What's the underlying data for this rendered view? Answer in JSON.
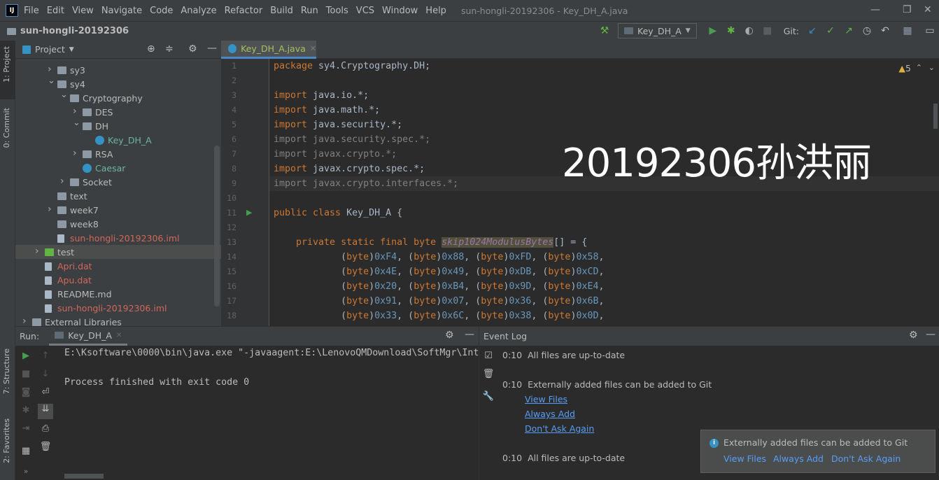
{
  "menu": {
    "items": [
      "File",
      "Edit",
      "View",
      "Navigate",
      "Code",
      "Analyze",
      "Refactor",
      "Build",
      "Run",
      "Tools",
      "VCS",
      "Window",
      "Help"
    ],
    "window_title": "sun-hongli-20192306 - Key_DH_A.java"
  },
  "nav": {
    "project_name": "sun-hongli-20192306"
  },
  "toolbar": {
    "run_config": "Key_DH_A",
    "git_label": "Git:"
  },
  "left_strip": {
    "project": "1: Project",
    "commit": "0: Commit",
    "structure": "7: Structure",
    "favorites": "2: Favorites"
  },
  "project_panel": {
    "title": "Project",
    "tree": [
      {
        "label": "sy3",
        "level": 2,
        "arrow": "collapsed",
        "icon": "folder",
        "color": "normal"
      },
      {
        "label": "sy4",
        "level": 2,
        "arrow": "expanded",
        "icon": "folder",
        "color": "normal"
      },
      {
        "label": "Cryptography",
        "level": 3,
        "arrow": "expanded",
        "icon": "folder",
        "color": "normal"
      },
      {
        "label": "DES",
        "level": 4,
        "arrow": "collapsed",
        "icon": "folder",
        "color": "normal"
      },
      {
        "label": "DH",
        "level": 4,
        "arrow": "expanded",
        "icon": "folder",
        "color": "normal"
      },
      {
        "label": "Key_DH_A",
        "level": 5,
        "arrow": "none",
        "icon": "class",
        "color": "class"
      },
      {
        "label": "RSA",
        "level": 4,
        "arrow": "collapsed",
        "icon": "folder",
        "color": "normal"
      },
      {
        "label": "Caesar",
        "level": 4,
        "arrow": "none",
        "icon": "class",
        "color": "class"
      },
      {
        "label": "Socket",
        "level": 3,
        "arrow": "collapsed",
        "icon": "folder",
        "color": "normal"
      },
      {
        "label": "text",
        "level": 2,
        "arrow": "none",
        "icon": "folder",
        "color": "normal"
      },
      {
        "label": "week7",
        "level": 2,
        "arrow": "collapsed",
        "icon": "folder",
        "color": "normal"
      },
      {
        "label": "week8",
        "level": 2,
        "arrow": "none",
        "icon": "folder",
        "color": "normal"
      },
      {
        "label": "sun-hongli-20192306.iml",
        "level": 2,
        "arrow": "none",
        "icon": "file",
        "color": "red"
      },
      {
        "label": "test",
        "level": 1,
        "arrow": "collapsed",
        "icon": "green-folder",
        "color": "normal",
        "selected": true
      },
      {
        "label": "Apri.dat",
        "level": 1,
        "arrow": "none",
        "icon": "file",
        "color": "red"
      },
      {
        "label": "Apu.dat",
        "level": 1,
        "arrow": "none",
        "icon": "file",
        "color": "red"
      },
      {
        "label": "README.md",
        "level": 1,
        "arrow": "none",
        "icon": "file",
        "color": "normal"
      },
      {
        "label": "sun-hongli-20192306.iml",
        "level": 1,
        "arrow": "none",
        "icon": "file",
        "color": "red"
      },
      {
        "label": "External Libraries",
        "level": 0,
        "arrow": "collapsed",
        "icon": "library",
        "color": "normal"
      }
    ]
  },
  "editor": {
    "tab": "Key_DH_A.java",
    "warnings": "5",
    "current_line": 9,
    "run_gutter_line": 11,
    "lines": [
      [
        [
          "package ",
          "kw"
        ],
        [
          "sy4.Cryptography.DH;",
          ""
        ]
      ],
      [],
      [
        [
          "import ",
          "kw"
        ],
        [
          "java.io.*;",
          ""
        ]
      ],
      [
        [
          "import ",
          "kw"
        ],
        [
          "java.math.*;",
          ""
        ]
      ],
      [
        [
          "import ",
          "kw"
        ],
        [
          "java.security.*;",
          ""
        ]
      ],
      [
        [
          "import java.security.spec.*;",
          "dim"
        ]
      ],
      [
        [
          "import javax.crypto.*;",
          "dim"
        ]
      ],
      [
        [
          "import ",
          "kw"
        ],
        [
          "javax.crypto.spec.*;",
          ""
        ]
      ],
      [
        [
          "import javax.crypto.interfaces.*;",
          "dim"
        ]
      ],
      [],
      [
        [
          "public class ",
          "kw"
        ],
        [
          "Key_DH_A {",
          ""
        ]
      ],
      [],
      [
        [
          "    private static final byte ",
          "kw"
        ],
        [
          "skip1024ModulusBytes",
          "hl"
        ],
        [
          "[] = {",
          ""
        ]
      ],
      [
        [
          "            (",
          ""
        ],
        [
          "byte",
          "kw"
        ],
        [
          ")",
          ""
        ],
        [
          "0xF4",
          "num"
        ],
        [
          ", (",
          ""
        ],
        [
          "byte",
          "kw"
        ],
        [
          ")",
          ""
        ],
        [
          "0x88",
          "num"
        ],
        [
          ", (",
          ""
        ],
        [
          "byte",
          "kw"
        ],
        [
          ")",
          ""
        ],
        [
          "0xFD",
          "num"
        ],
        [
          ", (",
          ""
        ],
        [
          "byte",
          "kw"
        ],
        [
          ")",
          ""
        ],
        [
          "0x58",
          "num"
        ],
        [
          ",",
          ""
        ]
      ],
      [
        [
          "            (",
          ""
        ],
        [
          "byte",
          "kw"
        ],
        [
          ")",
          ""
        ],
        [
          "0x4E",
          "num"
        ],
        [
          ", (",
          ""
        ],
        [
          "byte",
          "kw"
        ],
        [
          ")",
          ""
        ],
        [
          "0x49",
          "num"
        ],
        [
          ", (",
          ""
        ],
        [
          "byte",
          "kw"
        ],
        [
          ")",
          ""
        ],
        [
          "0xDB",
          "num"
        ],
        [
          ", (",
          ""
        ],
        [
          "byte",
          "kw"
        ],
        [
          ")",
          ""
        ],
        [
          "0xCD",
          "num"
        ],
        [
          ",",
          ""
        ]
      ],
      [
        [
          "            (",
          ""
        ],
        [
          "byte",
          "kw"
        ],
        [
          ")",
          ""
        ],
        [
          "0x20",
          "num"
        ],
        [
          ", (",
          ""
        ],
        [
          "byte",
          "kw"
        ],
        [
          ")",
          ""
        ],
        [
          "0xB4",
          "num"
        ],
        [
          ", (",
          ""
        ],
        [
          "byte",
          "kw"
        ],
        [
          ")",
          ""
        ],
        [
          "0x9D",
          "num"
        ],
        [
          ", (",
          ""
        ],
        [
          "byte",
          "kw"
        ],
        [
          ")",
          ""
        ],
        [
          "0xE4",
          "num"
        ],
        [
          ",",
          ""
        ]
      ],
      [
        [
          "            (",
          ""
        ],
        [
          "byte",
          "kw"
        ],
        [
          ")",
          ""
        ],
        [
          "0x91",
          "num"
        ],
        [
          ", (",
          ""
        ],
        [
          "byte",
          "kw"
        ],
        [
          ")",
          ""
        ],
        [
          "0x07",
          "num"
        ],
        [
          ", (",
          ""
        ],
        [
          "byte",
          "kw"
        ],
        [
          ")",
          ""
        ],
        [
          "0x36",
          "num"
        ],
        [
          ", (",
          ""
        ],
        [
          "byte",
          "kw"
        ],
        [
          ")",
          ""
        ],
        [
          "0x6B",
          "num"
        ],
        [
          ",",
          ""
        ]
      ],
      [
        [
          "            (",
          ""
        ],
        [
          "byte",
          "kw"
        ],
        [
          ")",
          ""
        ],
        [
          "0x33",
          "num"
        ],
        [
          ", (",
          ""
        ],
        [
          "byte",
          "kw"
        ],
        [
          ")",
          ""
        ],
        [
          "0x6C",
          "num"
        ],
        [
          ", (",
          ""
        ],
        [
          "byte",
          "kw"
        ],
        [
          ")",
          ""
        ],
        [
          "0x38",
          "num"
        ],
        [
          ", (",
          ""
        ],
        [
          "byte",
          "kw"
        ],
        [
          ")",
          ""
        ],
        [
          "0x0D",
          "num"
        ],
        [
          ",",
          ""
        ]
      ]
    ]
  },
  "watermark": "20192306孙洪丽",
  "run_panel": {
    "label": "Run:",
    "tab": "Key_DH_A",
    "output": [
      "E:\\Ksoftware\\0000\\bin\\java.exe \"-javaagent:E:\\LenovoQMDownload\\SoftMgr\\Int",
      "",
      "Process finished with exit code 0"
    ]
  },
  "event_log": {
    "title": "Event Log",
    "entries": [
      {
        "time": "0:10",
        "text": "All files are up-to-date",
        "links": []
      },
      {
        "time": "0:10",
        "text": "Externally added files can be added to Git",
        "links": [
          "View Files",
          "Always Add",
          "Don't Ask Again"
        ]
      },
      {
        "time": "0:10",
        "text": "All files are up-to-date",
        "links": []
      }
    ]
  },
  "notification": {
    "message": "Externally added files can be added to Git",
    "links": [
      "View Files",
      "Always Add",
      "Don't Ask Again"
    ]
  }
}
